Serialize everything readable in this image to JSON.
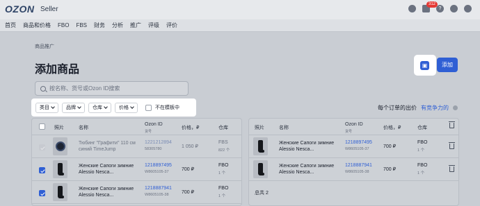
{
  "app": {
    "logo": "OZON",
    "logo_sub": "Seller",
    "notif_count": "312"
  },
  "nav": [
    "首页",
    "商品和价格",
    "FBO",
    "FBS",
    "财务",
    "分析",
    "推广",
    "评级",
    "评价"
  ],
  "breadcrumb": "商品推广",
  "title": "添加商品",
  "add_label": "添加",
  "search_placeholder": "按名称、货号或Ozon ID搜索",
  "filters": {
    "category": "类目",
    "brand": "品牌",
    "warehouse": "仓库",
    "price": "价格",
    "not_in_template": "不在模板中"
  },
  "bid_info": {
    "label": "每个订单的出价",
    "link": "有竞争力的"
  },
  "left_table": {
    "headers": {
      "photo": "照片",
      "name": "名称",
      "ozon_id": "Ozon ID",
      "ozon_id_sub": "货号",
      "price": "价格，₽",
      "warehouse": "仓库"
    },
    "rows": [
      {
        "name": "Тюбинг \"Графити\" 110 см синий TimeJump",
        "id": "1221212894",
        "sku": "58305780",
        "price": "1 050 ₽",
        "wh": "FBS",
        "wh_sub": "822 个",
        "thumb": "watch",
        "muted": true
      },
      {
        "name": "Женские Сапоги зимние Alessio Nesca...",
        "id": "1218897495",
        "sku": "W8605105-37",
        "price": "700 ₽",
        "wh": "FBO",
        "wh_sub": "1 个",
        "thumb": "boot",
        "muted": false
      },
      {
        "name": "Женские Сапоги зимние Alessio Nesca...",
        "id": "1218887941",
        "sku": "W8605105-38",
        "price": "700 ₽",
        "wh": "FBO",
        "wh_sub": "1 个",
        "thumb": "boot",
        "muted": false
      }
    ]
  },
  "right_table": {
    "headers": {
      "photo": "照片",
      "name": "名称",
      "ozon_id": "Ozon ID",
      "ozon_id_sub": "货号",
      "price": "价格，₽",
      "warehouse": "仓库"
    },
    "rows": [
      {
        "name": "Женские Сапоги зимние Alessio Nesca...",
        "id": "1218897495",
        "sku": "W8605105-37",
        "price": "700 ₽",
        "wh": "FBO",
        "wh_sub": "1 个"
      },
      {
        "name": "Женские Сапоги зимние Alessio Nesca...",
        "id": "1218887941",
        "sku": "W8605105-38",
        "price": "700 ₽",
        "wh": "FBO",
        "wh_sub": "1 个"
      }
    ],
    "total": "总共 2"
  }
}
